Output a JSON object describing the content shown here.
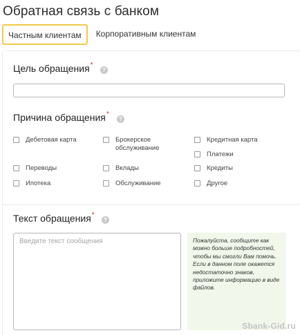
{
  "page_title": "Обратная связь с банком",
  "tabs": [
    {
      "label": "Частным клиентам",
      "active": true
    },
    {
      "label": "Корпоративным клиентам",
      "active": false
    }
  ],
  "purpose": {
    "label": "Цель обращения",
    "required_mark": "*",
    "help_icon": "?",
    "value": ""
  },
  "reason": {
    "label": "Причина обращения",
    "required_mark": "*",
    "help_icon": "?",
    "options": [
      "Дебетовая карта",
      "Брокерское обслуживание",
      "Кредитная карта",
      "Платежи",
      "Переводы",
      "Вклады",
      "Кредиты",
      "Ипотека",
      "Обслуживание",
      "Другое"
    ]
  },
  "message": {
    "label": "Текст обращения",
    "required_mark": "*",
    "help_icon": "?",
    "placeholder": "Введите текст сообщения",
    "hint": "Пожалуйста, сообщите как можно больше подробностей, чтобы мы смогли Вам помочь. Если в данном поле окажется недостаточно знаков, приложите информацию в виде файлов."
  },
  "watermark": "Sbank-Gid.ru",
  "colors": {
    "active_tab_border": "#f2c94c",
    "required_mark": "#c0392b",
    "hint_background": "#f1f7ea"
  }
}
